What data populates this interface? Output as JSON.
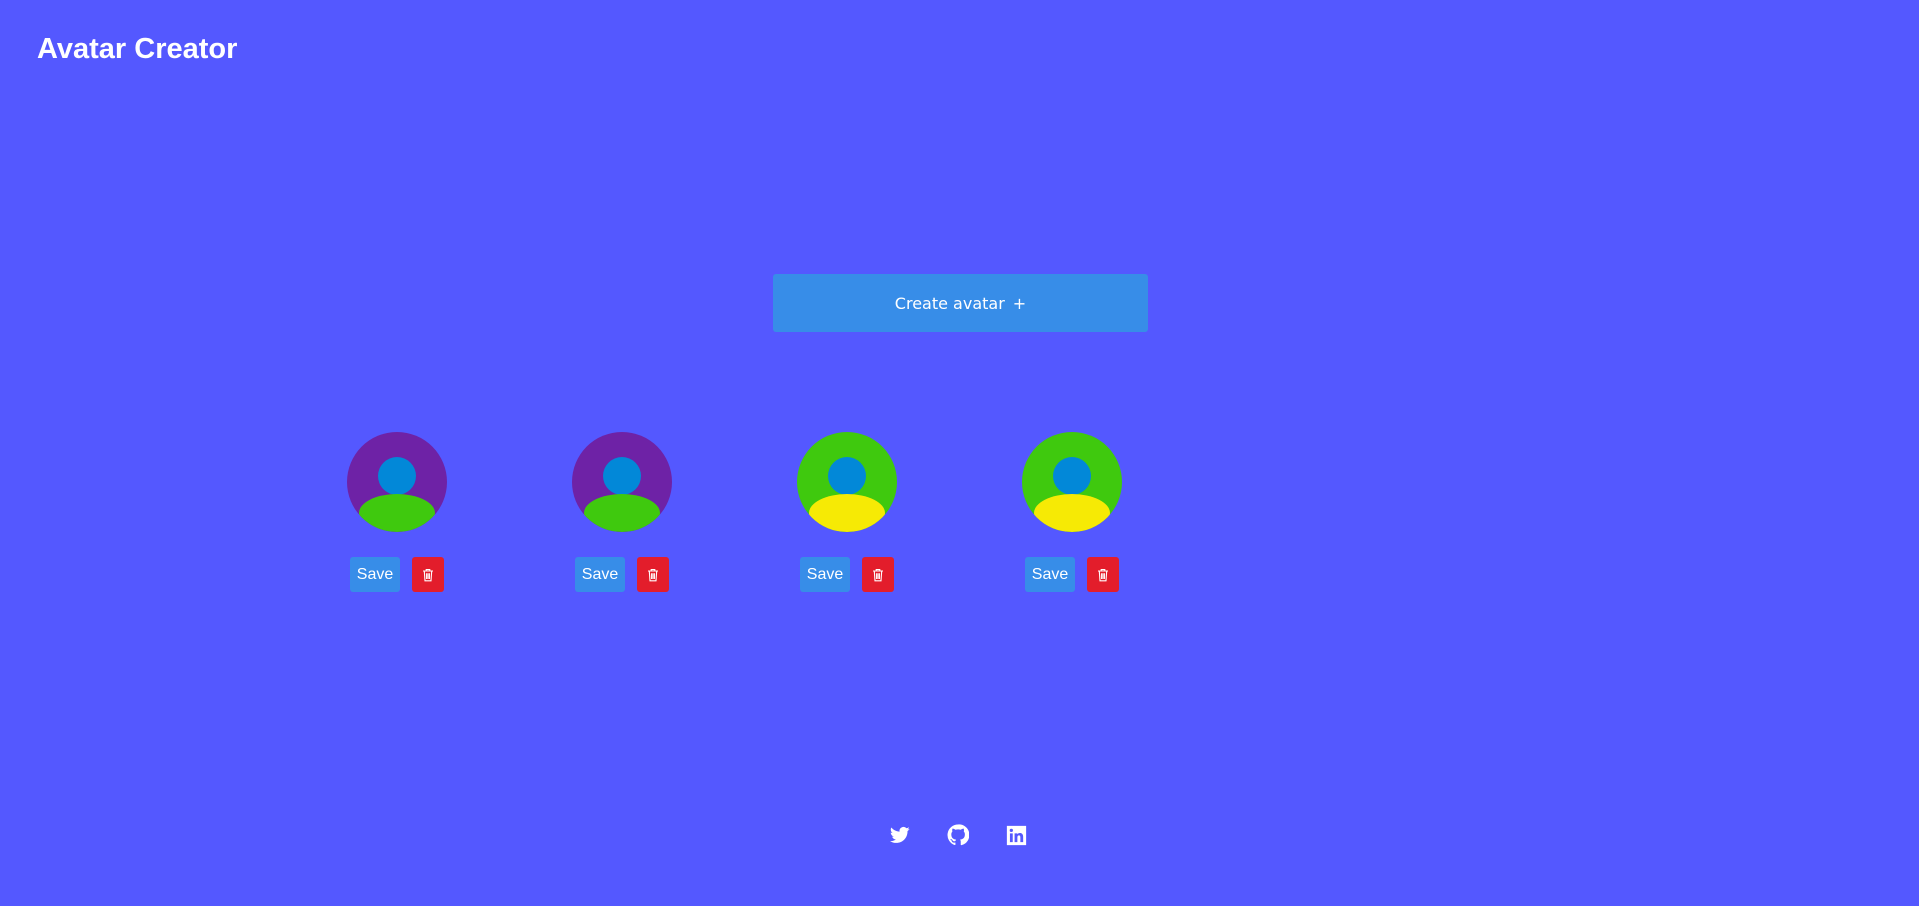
{
  "header": {
    "title": "Avatar Creator"
  },
  "create_button": {
    "label": "Create avatar",
    "icon_text": "+"
  },
  "avatars": [
    {
      "background": "#6E22A6",
      "head": "#0288D8",
      "body": "#3FC90E",
      "save_label": "Save",
      "delete_icon": "trash-icon"
    },
    {
      "background": "#6E22A6",
      "head": "#0288D8",
      "body": "#3FC90E",
      "save_label": "Save",
      "delete_icon": "trash-icon"
    },
    {
      "background": "#3FC90E",
      "head": "#0288D8",
      "body": "#F6EA05",
      "save_label": "Save",
      "delete_icon": "trash-icon"
    },
    {
      "background": "#3FC90E",
      "head": "#0288D8",
      "body": "#F6EA05",
      "save_label": "Save",
      "delete_icon": "trash-icon"
    }
  ],
  "footer": {
    "links": [
      "twitter-icon",
      "github-icon",
      "linkedin-icon"
    ]
  },
  "colors": {
    "page_background": "#5458FF",
    "primary_button": "#378DE8",
    "danger_button": "#E31D2B",
    "text": "#FFFFFF"
  }
}
